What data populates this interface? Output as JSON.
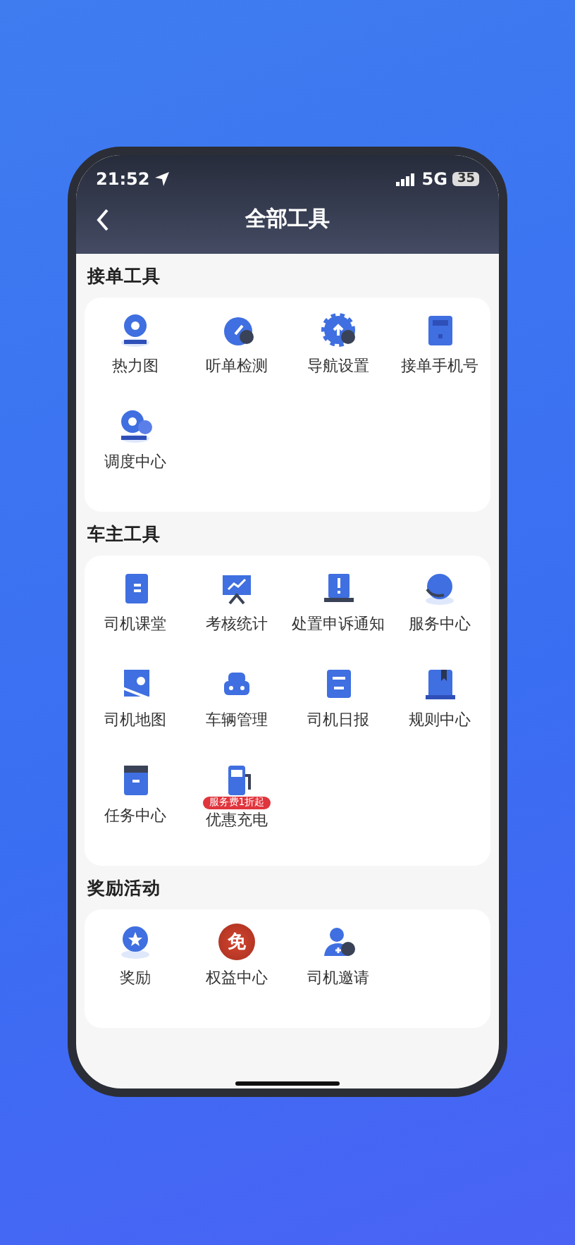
{
  "status_bar": {
    "time": "21:52",
    "network": "5G",
    "battery": "35"
  },
  "nav": {
    "title": "全部工具"
  },
  "sections": [
    {
      "title": "接单工具",
      "items": [
        {
          "label": "热力图"
        },
        {
          "label": "听单检测"
        },
        {
          "label": "导航设置"
        },
        {
          "label": "接单手机号"
        },
        {
          "label": "调度中心"
        }
      ]
    },
    {
      "title": "车主工具",
      "items": [
        {
          "label": "司机课堂"
        },
        {
          "label": "考核统计"
        },
        {
          "label": "处置申诉通知"
        },
        {
          "label": "服务中心"
        },
        {
          "label": "司机地图"
        },
        {
          "label": "车辆管理"
        },
        {
          "label": "司机日报"
        },
        {
          "label": "规则中心"
        },
        {
          "label": "任务中心"
        },
        {
          "label": "优惠充电",
          "tag": "服务费1折起"
        }
      ]
    },
    {
      "title": "奖励活动",
      "items": [
        {
          "label": "奖励"
        },
        {
          "label": "权益中心",
          "glyph": "免"
        },
        {
          "label": "司机邀请"
        }
      ]
    }
  ]
}
